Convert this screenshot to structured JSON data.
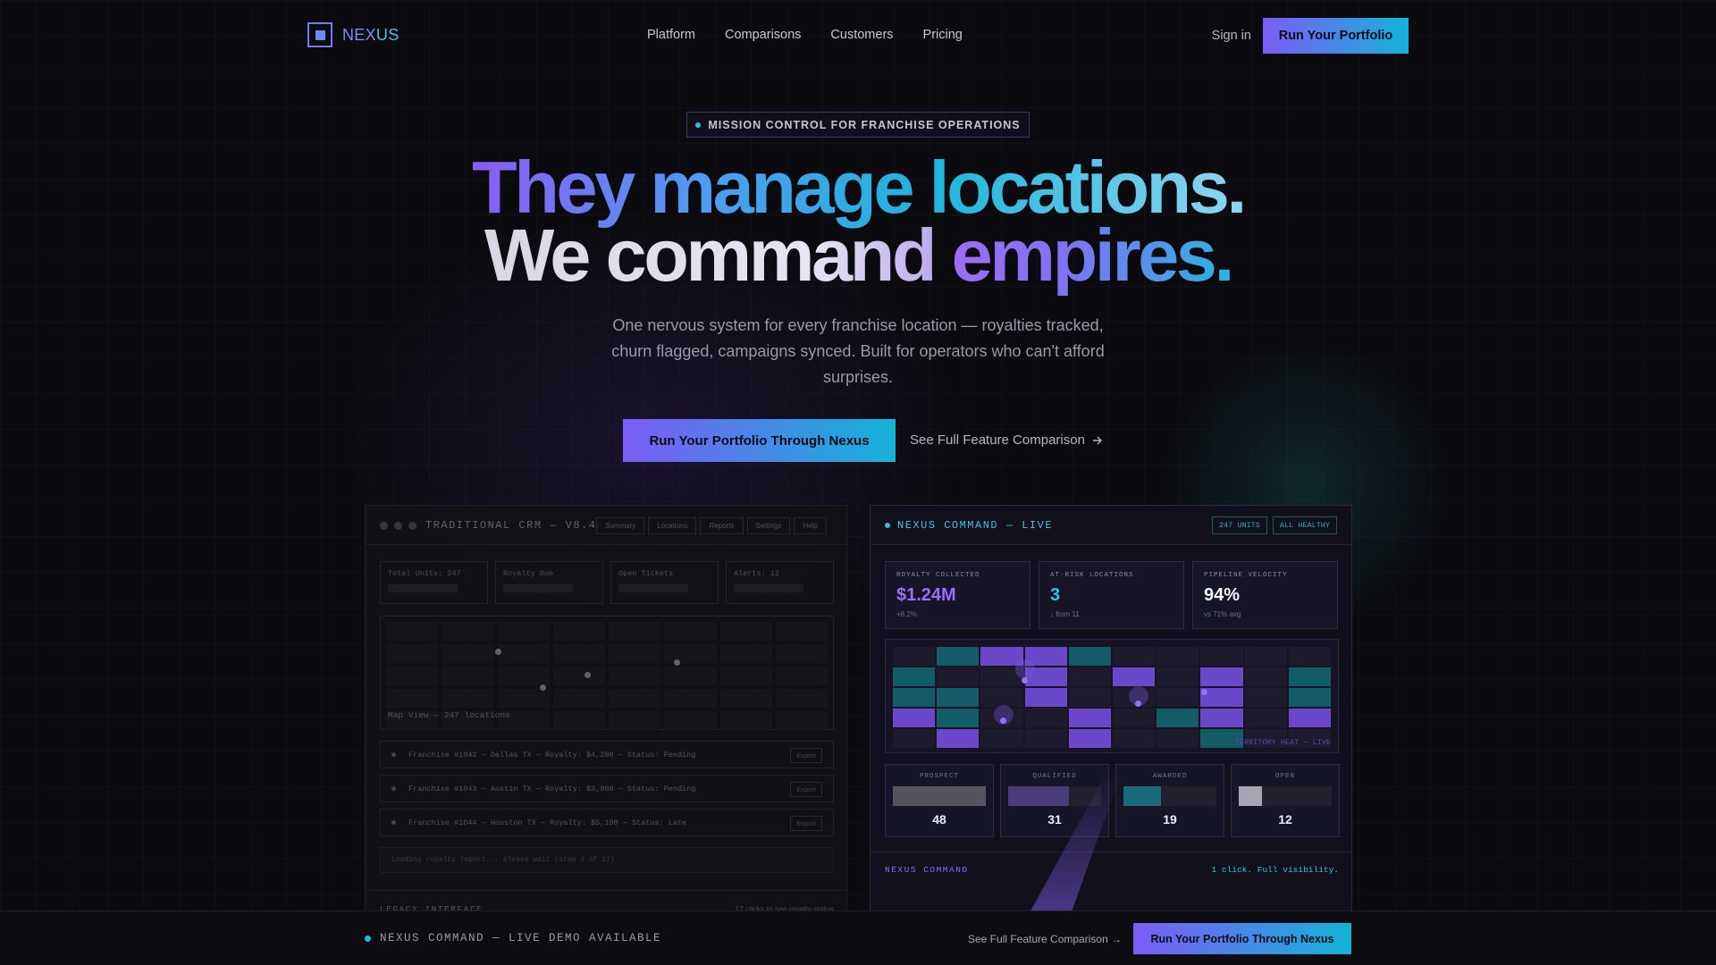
{
  "brand": {
    "name_part1": "NEX",
    "name_part2": "US"
  },
  "nav": {
    "links": [
      "Platform",
      "Comparisons",
      "Customers",
      "Pricing"
    ],
    "sign_in": "Sign in",
    "cta": "Run Your Portfolio"
  },
  "hero": {
    "badge": "MISSION CONTROL FOR FRANCHISE OPERATIONS",
    "headline_line1": "They manage locations.",
    "headline_line2a": "We command ",
    "headline_line2b": "empires.",
    "subtitle": "One nervous system for every franchise location — royalties tracked, churn flagged, campaigns synced. Built for operators who can't afford surprises.",
    "cta": "Run Your Portfolio Through Nexus",
    "link": "See Full Feature Comparison"
  },
  "legacy": {
    "title": "TRADITIONAL CRM — V8.4",
    "tabs": [
      "Summary",
      "Locations",
      "Reports",
      "Settings",
      "Help"
    ],
    "stats": [
      "Total Units: 247",
      "Royalty Due",
      "Open Tickets",
      "Alerts: 12"
    ],
    "map_label": "Map View — 247 locations",
    "rows": [
      "Franchise #1042 — Dallas TX — Royalty: $4,200 — Status: Pending",
      "Franchise #1043 — Austin TX — Royalty: $3,900 — Status: Pending",
      "Franchise #1044 — Houston TX — Royalty: $5,100 — Status: Late"
    ],
    "row_action": "Export",
    "loading": "Loading royalty report... please wait (step 3 of 17)",
    "footer_left": "LEGACY INTERFACE",
    "footer_right": "17 clicks to see royalty status"
  },
  "nexus": {
    "title": "NEXUS COMMAND — LIVE",
    "badges": [
      "247 UNITS",
      "ALL HEALTHY"
    ],
    "stats": [
      {
        "label": "ROYALTY COLLECTED",
        "value": "$1.24M",
        "sub": "+8.2%",
        "color": "#9b6ef7"
      },
      {
        "label": "AT-RISK LOCATIONS",
        "value": "3",
        "sub": "↓ from 11",
        "color": "#2ec3e3"
      },
      {
        "label": "PIPELINE VELOCITY",
        "value": "94%",
        "sub": "vs 71% avg",
        "color": "#f2f2f8"
      }
    ],
    "map_label": "TERRITORY HEAT — LIVE",
    "pipeline": [
      {
        "label": "PROSPECT",
        "value": "48",
        "fill": 1.0,
        "color": "#55535f"
      },
      {
        "label": "QUALIFIED",
        "value": "31",
        "fill": 0.65,
        "color": "#4a3d7a"
      },
      {
        "label": "AWARDED",
        "value": "19",
        "fill": 0.4,
        "color": "#1a6a7c"
      },
      {
        "label": "OPEN",
        "value": "12",
        "fill": 0.25,
        "color": "#a7a5b3"
      }
    ],
    "footer_left": "NEXUS COMMAND",
    "footer_right": "1 click. Full visibility."
  },
  "bottombar": {
    "label": "NEXUS COMMAND — LIVE DEMO AVAILABLE",
    "link": "See Full Feature Comparison →",
    "cta": "Run Your Portfolio Through Nexus"
  },
  "colors": {
    "accent_purple": "#7c5cf6",
    "accent_cyan": "#14b3d8",
    "background": "#0b0b0f"
  }
}
